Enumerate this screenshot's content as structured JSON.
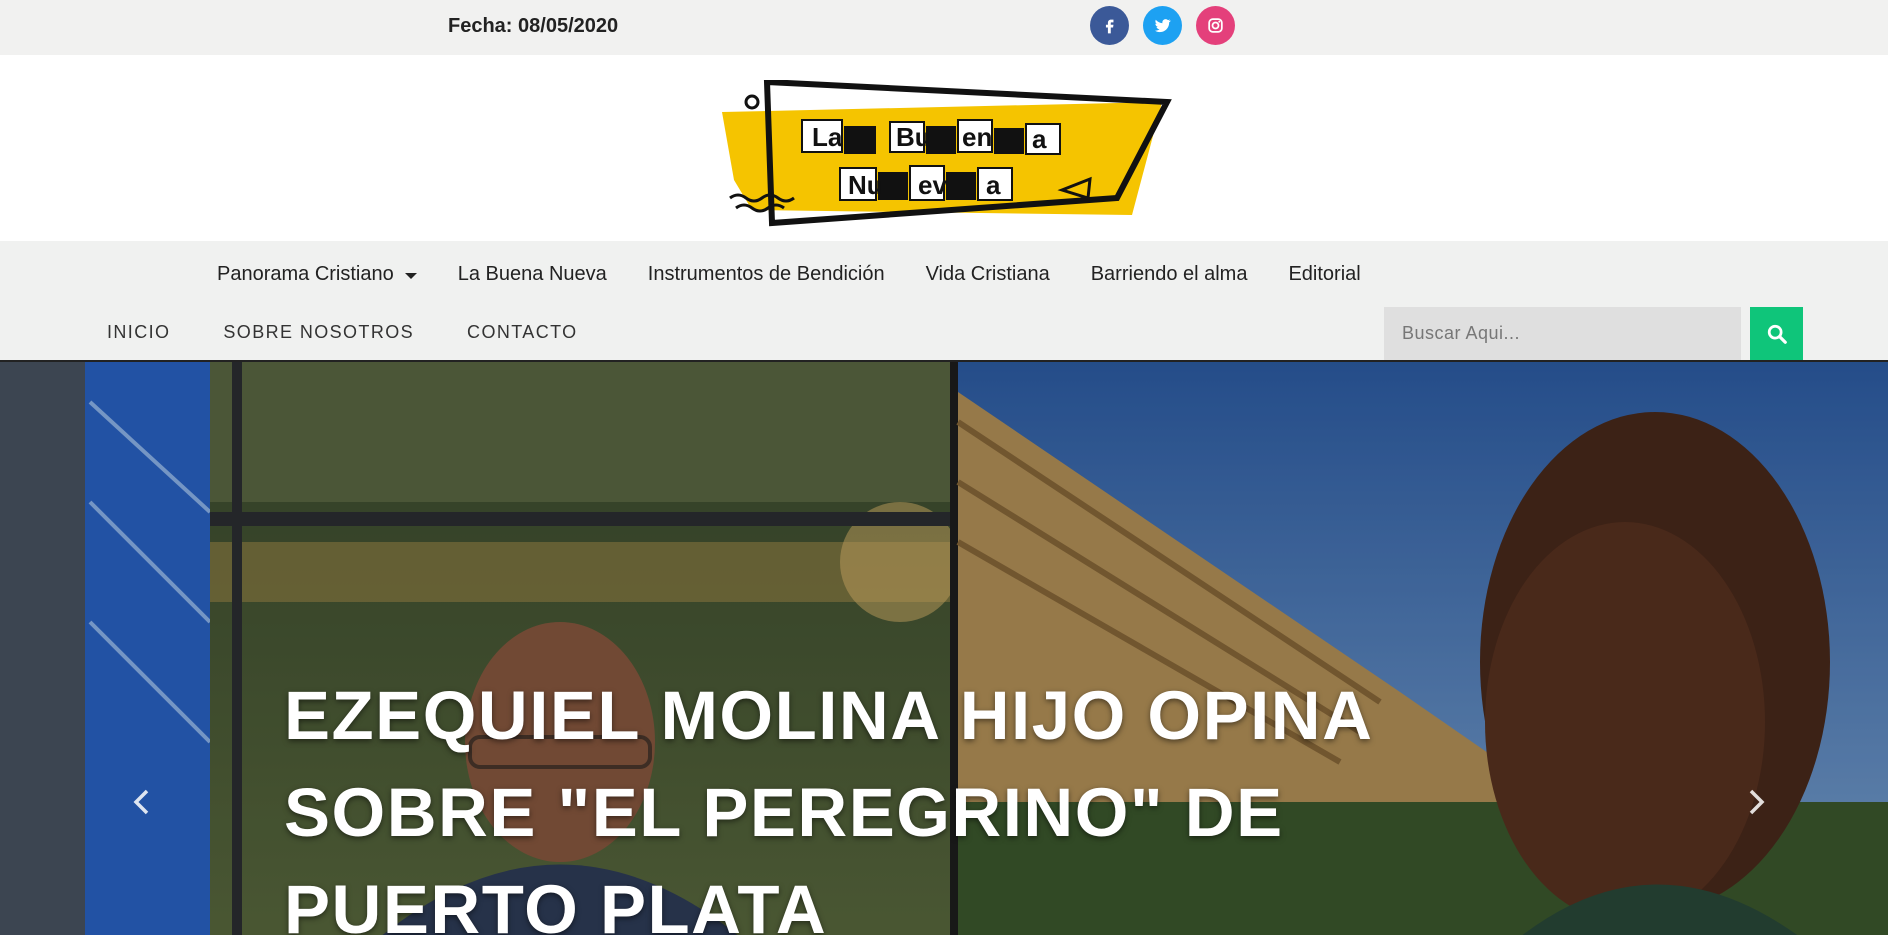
{
  "topbar": {
    "date": "Fecha: 08/05/2020",
    "socials": [
      {
        "icon": "facebook-icon",
        "color": "#3b5998"
      },
      {
        "icon": "twitter-icon",
        "color": "#1da1f2"
      },
      {
        "icon": "instagram-icon",
        "color": "#e4407b"
      }
    ]
  },
  "logo": {
    "line1": "La Buena",
    "line2": "Nueva",
    "bg_color": "#f5c400"
  },
  "nav": {
    "primary": [
      {
        "label": "Panorama Cristiano",
        "dropdown": true
      },
      {
        "label": "La Buena Nueva"
      },
      {
        "label": "Instrumentos de Bendición"
      },
      {
        "label": "Vida Cristiana"
      },
      {
        "label": "Barriendo el alma"
      },
      {
        "label": "Editorial"
      }
    ],
    "secondary": [
      {
        "label": "INICIO"
      },
      {
        "label": "SOBRE NOSOTROS"
      },
      {
        "label": "CONTACTO"
      }
    ],
    "search": {
      "placeholder": "Buscar Aqui...",
      "button_color": "#0fc57a"
    }
  },
  "hero": {
    "headline": "EZEQUIEL MOLINA HIJO OPINA SOBRE \"EL PEREGRINO\" DE PUERTO PLATA",
    "prev_icon": "chevron-left-icon",
    "next_icon": "chevron-right-icon"
  }
}
